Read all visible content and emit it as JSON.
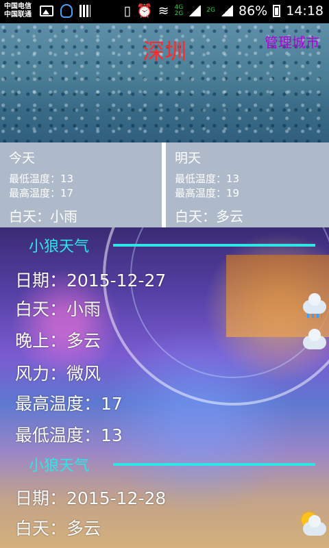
{
  "status_bar": {
    "carrier_1": "中国电信",
    "carrier_2": "中国联通",
    "battery": "86%",
    "time": "14:18",
    "icons": [
      "image-icon",
      "qq-icon",
      "barcode-icon",
      "vibrate-icon",
      "alarm-icon",
      "wifi-icon",
      "signal-icon",
      "battery-icon"
    ]
  },
  "header": {
    "city": "深圳",
    "manage_city": "管理城市",
    "city_color": "#ff2b2b",
    "manage_color": "#b000d8"
  },
  "forecast": {
    "today": {
      "day": "今天",
      "low": "最低温度：13",
      "high": "最高温度：17",
      "weather": "白天：小雨"
    },
    "tomorrow": {
      "day": "明天",
      "low": "最低温度：13",
      "high": "最高温度：19",
      "weather": "白天：多云"
    }
  },
  "list": {
    "accent": "#2ee6e6",
    "items": [
      {
        "brand": "小狼天气",
        "date": "日期：2015-12-27",
        "day": "白天：小雨",
        "night": "晚上：多云",
        "wind": "风力：微风",
        "high": "最高温度：17",
        "low": "最低温度：13",
        "day_icon": "rain-cloud-icon",
        "night_icon": "cloud-icon"
      },
      {
        "brand": "小狼天气",
        "date": "日期：2015-12-28",
        "day": "白天：多云",
        "day_icon": "sun-cloud-icon"
      }
    ]
  }
}
